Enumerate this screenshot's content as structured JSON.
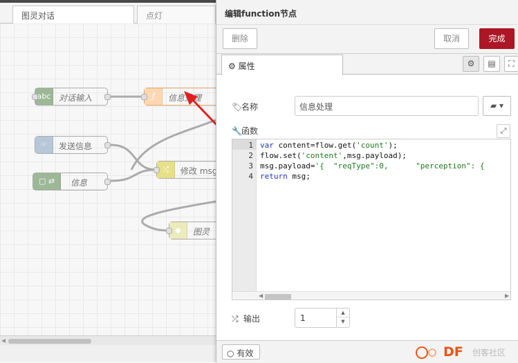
{
  "workspace": {
    "tabs": [
      {
        "label": "图灵对话",
        "active": true
      },
      {
        "label": "点灯",
        "active": false
      }
    ],
    "nodes": [
      {
        "label": "对话输入",
        "icon": "abc-icon",
        "color": "#87a980"
      },
      {
        "label": "信息处理",
        "icon": "function-icon",
        "color": "#fdd0a2"
      },
      {
        "label": "发送信息",
        "icon": "inject-icon",
        "color": "#a6bbcf"
      },
      {
        "label": "修改 msg",
        "icon": "change-icon",
        "color": "#e2d96e"
      },
      {
        "label": "信息",
        "icon": "arrow-icon",
        "color": "#87a980"
      },
      {
        "label": "图灵",
        "icon": "http-icon",
        "color": "#e7e7ae"
      }
    ]
  },
  "tray": {
    "title": "编辑function节点",
    "toolbar": {
      "delete_label": "删除",
      "cancel_label": "取消",
      "done_label": "完成"
    },
    "tabs": {
      "properties_label": "属性"
    },
    "name": {
      "label": "名称",
      "value": "信息处理"
    },
    "function": {
      "label": "函数",
      "lines": [
        {
          "num": "1",
          "code": "var content=flow.get('count');"
        },
        {
          "num": "2",
          "code": "flow.set('content',msg.payload);"
        },
        {
          "num": "3",
          "code": "msg.payload='{  \"reqType\":0,      \"perception\": {"
        },
        {
          "num": "4",
          "code": "return msg;"
        }
      ]
    },
    "outputs": {
      "label": "输出",
      "value": "1"
    },
    "footer": {
      "enabled_label": "有效"
    }
  },
  "watermark": {
    "brand": "DF",
    "text": "创客社区"
  },
  "colors": {
    "accent": "#ad1625",
    "arrow": "#e02020",
    "watermark": "#e8541a"
  }
}
